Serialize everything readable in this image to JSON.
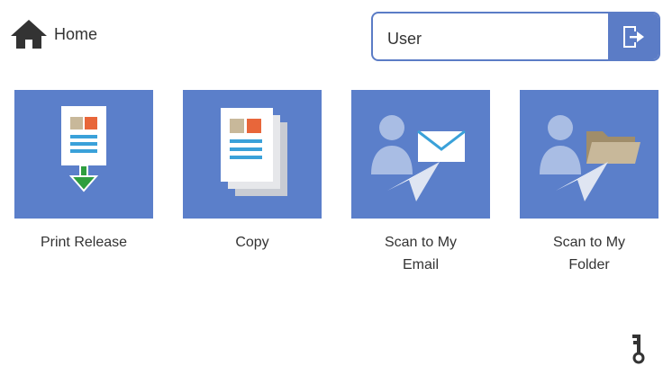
{
  "header": {
    "home_label": "Home",
    "user_value": "User",
    "home_icon": "house-icon",
    "logout_icon": "logout-icon"
  },
  "tiles": [
    {
      "line1": "Print Release",
      "line2": "",
      "icon": "print-release-icon"
    },
    {
      "line1": "Copy",
      "line2": "",
      "icon": "copy-icon"
    },
    {
      "line1": "Scan to My",
      "line2": "Email",
      "icon": "scan-to-email-icon"
    },
    {
      "line1": "Scan to My",
      "line2": "Folder",
      "icon": "scan-to-folder-icon"
    }
  ],
  "footer": {
    "key_icon": "key-icon"
  },
  "colors": {
    "accent": "#5b7cc6",
    "tile_background": "#5b7fca",
    "text": "#333333"
  }
}
